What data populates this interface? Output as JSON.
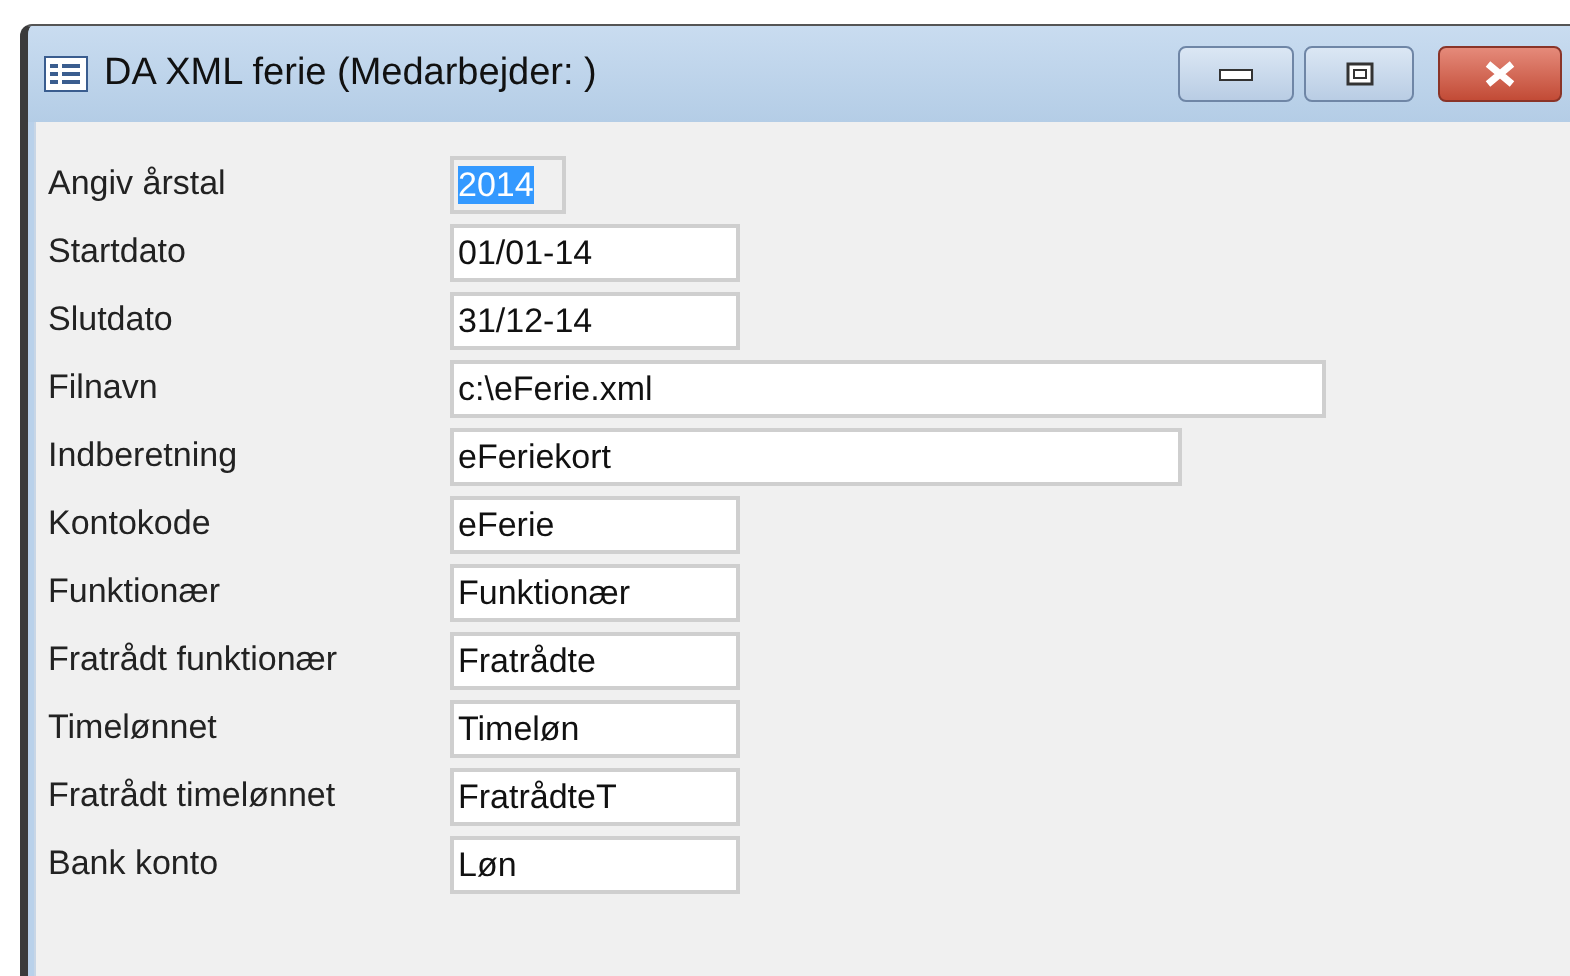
{
  "window": {
    "title": "DA XML ferie (Medarbejder: )"
  },
  "fields": [
    {
      "label": "Angiv årstal",
      "value": "2014",
      "kind": "year",
      "selected": true
    },
    {
      "label": "Startdato",
      "value": "01/01-14",
      "kind": "short",
      "selected": false
    },
    {
      "label": "Slutdato",
      "value": "31/12-14",
      "kind": "short",
      "selected": false
    },
    {
      "label": "Filnavn",
      "value": "c:\\eFerie.xml",
      "kind": "long",
      "selected": false
    },
    {
      "label": "Indberetning",
      "value": "eFeriekort",
      "kind": "medium",
      "selected": false
    },
    {
      "label": "Kontokode",
      "value": "eFerie",
      "kind": "short",
      "selected": false
    },
    {
      "label": "Funktionær",
      "value": "Funktionær",
      "kind": "short",
      "selected": false
    },
    {
      "label": "Fratrådt funktionær",
      "value": "Fratrådte",
      "kind": "short",
      "selected": false
    },
    {
      "label": "Timelønnet",
      "value": "Timeløn",
      "kind": "short",
      "selected": false
    },
    {
      "label": "Fratrådt timelønnet",
      "value": "FratrådteT",
      "kind": "short",
      "selected": false
    },
    {
      "label": "Bank konto",
      "value": "Løn",
      "kind": "short",
      "selected": false
    }
  ]
}
